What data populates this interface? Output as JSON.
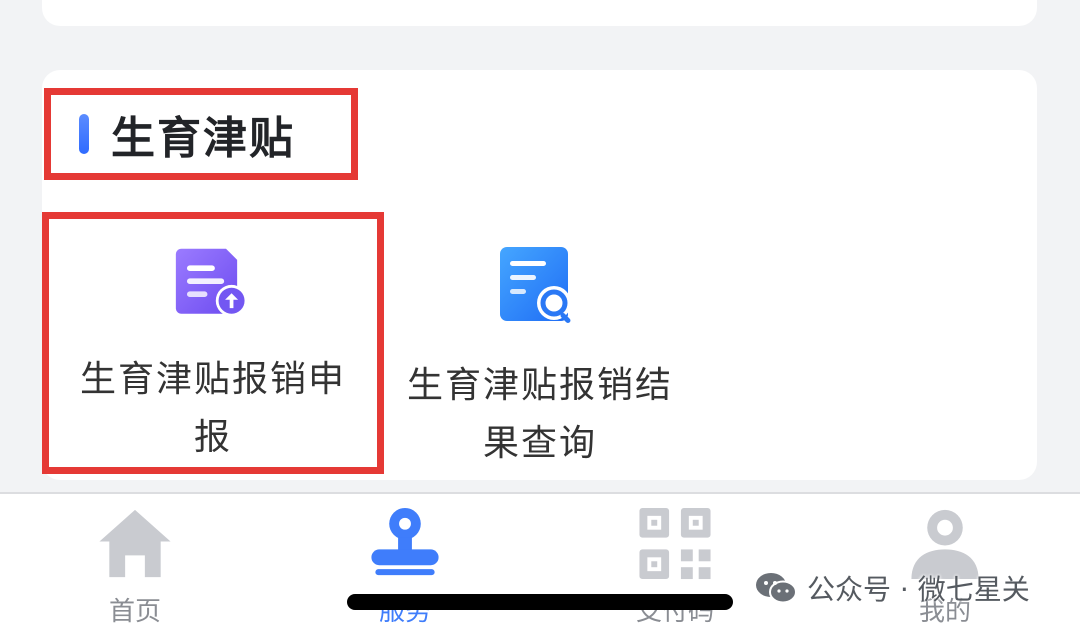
{
  "section": {
    "title": "生育津贴"
  },
  "services": [
    {
      "label": "生育津贴报销申报",
      "icon": "document-upload-icon"
    },
    {
      "label": "生育津贴报销结果查询",
      "icon": "document-search-icon"
    }
  ],
  "tabbar": {
    "items": [
      {
        "label": "首页",
        "icon": "home-icon",
        "active": false
      },
      {
        "label": "服务",
        "icon": "stamp-icon",
        "active": true
      },
      {
        "label": "支付码",
        "icon": "qr-code-icon",
        "active": false
      },
      {
        "label": "我的",
        "icon": "user-icon",
        "active": false
      }
    ]
  },
  "watermark": {
    "text": "公众号 · 微七星关"
  },
  "colors": {
    "accent": "#3f7dfb",
    "highlight": "#e53935",
    "icon_purple": "#7b5cf5",
    "icon_blue": "#2f80ff",
    "tab_inactive": "#c9cbd0"
  }
}
